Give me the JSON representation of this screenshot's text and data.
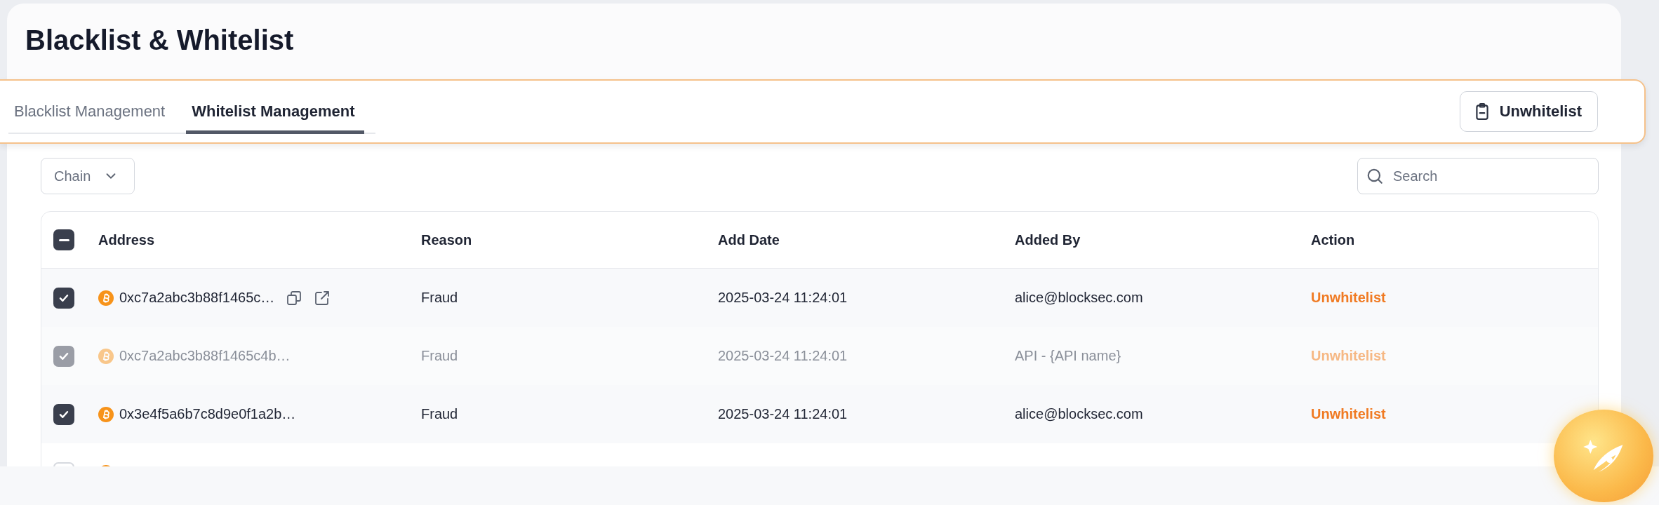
{
  "page": {
    "title": "Blacklist & Whitelist"
  },
  "tabs": [
    {
      "label": "Blacklist Management",
      "selected": false
    },
    {
      "label": "Whitelist Management",
      "selected": true
    }
  ],
  "toolbar_button": {
    "label": "Unwhitelist"
  },
  "chain_filter": {
    "placeholder": "Chain"
  },
  "search": {
    "placeholder": "Search"
  },
  "table": {
    "select_all": {
      "indeterminate": true
    },
    "columns": [
      "Address",
      "Reason",
      "Add Date",
      "Added By",
      "Action"
    ],
    "rows": [
      {
        "checked": true,
        "disabled": false,
        "hovered": true,
        "address": "0xc7a2abc3b88f1465c…",
        "reason": "Fraud",
        "add_date": "2025-03-24 11:24:01",
        "added_by": "alice@blocksec.com",
        "action": "Unwhitelist"
      },
      {
        "checked": true,
        "disabled": true,
        "hovered": false,
        "address": "0xc7a2abc3b88f1465c4b…",
        "reason": "Fraud",
        "add_date": "2025-03-24 11:24:01",
        "added_by": "API - {API name}",
        "action": "Unwhitelist"
      },
      {
        "checked": true,
        "disabled": false,
        "hovered": false,
        "address": "0x3e4f5a6b7c8d9e0f1a2b…",
        "reason": "Fraud",
        "add_date": "2025-03-24 11:24:01",
        "added_by": "alice@blocksec.com",
        "action": "Unwhitelist"
      },
      {
        "checked": false,
        "disabled": false,
        "hovered": false
      }
    ]
  }
}
